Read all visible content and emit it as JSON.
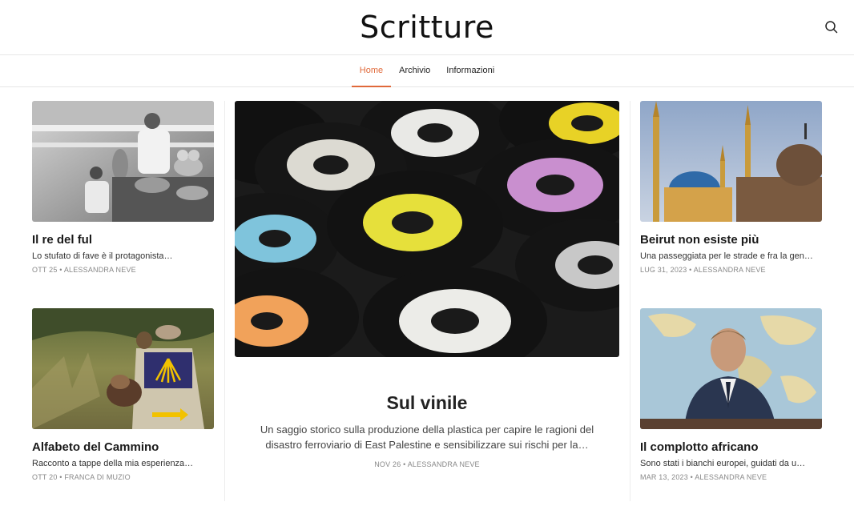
{
  "site": {
    "title": "Scritture"
  },
  "nav": [
    {
      "label": "Home",
      "active": true
    },
    {
      "label": "Archivio",
      "active": false
    },
    {
      "label": "Informazioni",
      "active": false
    }
  ],
  "featured": {
    "title": "Sul vinile",
    "excerpt": "Un saggio storico sulla produzione della plastica per capire le ragioni del disastro ferroviario di East Palestine e sensibilizzare sui rischi per la…",
    "date": "NOV 26",
    "author": "ALESSANDRA NEVE"
  },
  "posts": [
    {
      "title": "Il re del ful",
      "excerpt": "Lo stufato di fave è il protagonista…",
      "date": "OTT 25",
      "author": "ALESSANDRA NEVE"
    },
    {
      "title": "Alfabeto del Cammino",
      "excerpt": "Racconto a tappe della mia esperienza…",
      "date": "OTT 20",
      "author": "FRANCA DI MUZIO"
    },
    {
      "title": "Beirut non esiste più",
      "excerpt": "Una passeggiata per le strade e fra la gen…",
      "date": "LUG 31, 2023",
      "author": "ALESSANDRA NEVE"
    },
    {
      "title": "Il complotto africano",
      "excerpt": "Sono stati i bianchi europei, guidati da u…",
      "date": "MAR 13, 2023",
      "author": "ALESSANDRA NEVE"
    }
  ],
  "meta_separator": " • ",
  "icons": {
    "search": "search-icon"
  },
  "colors": {
    "accent": "#e0693a"
  }
}
